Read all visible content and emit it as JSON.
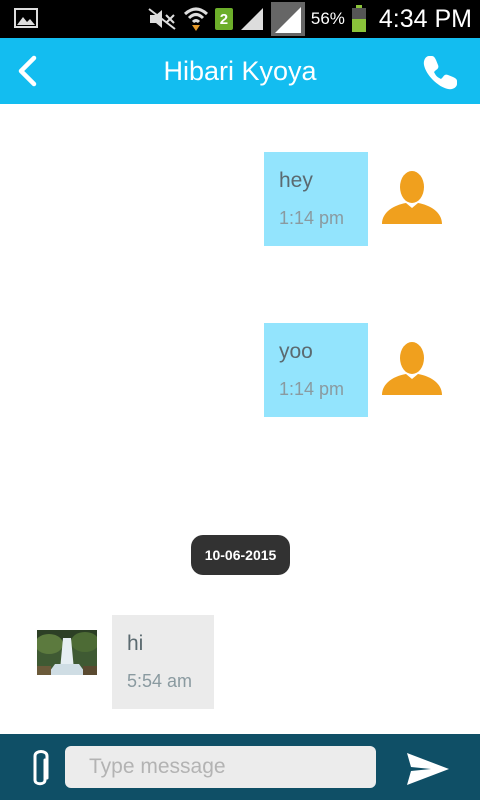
{
  "status_bar": {
    "sim_badge": "2",
    "battery_percent": "56%",
    "time": "4:34 PM"
  },
  "header": {
    "title": "Hibari Kyoya",
    "back_icon": "chevron-left-icon",
    "call_icon": "phone-icon"
  },
  "messages": [
    {
      "direction": "outgoing",
      "text": "hey",
      "time": "1:14 pm"
    },
    {
      "direction": "outgoing",
      "text": "yoo",
      "time": "1:14 pm"
    },
    {
      "direction": "incoming",
      "text": "hi",
      "time": "5:54 am"
    }
  ],
  "date_separator": "10-06-2015",
  "composer": {
    "placeholder": "Type message",
    "value": "",
    "attach_icon": "paperclip-icon",
    "send_icon": "send-icon"
  },
  "colors": {
    "header": "#13bdf0",
    "outgoing_bubble": "#93e4fd",
    "incoming_bubble": "#ebebeb",
    "composer_bar": "#0f4f66",
    "avatar": "#f0a01e"
  }
}
